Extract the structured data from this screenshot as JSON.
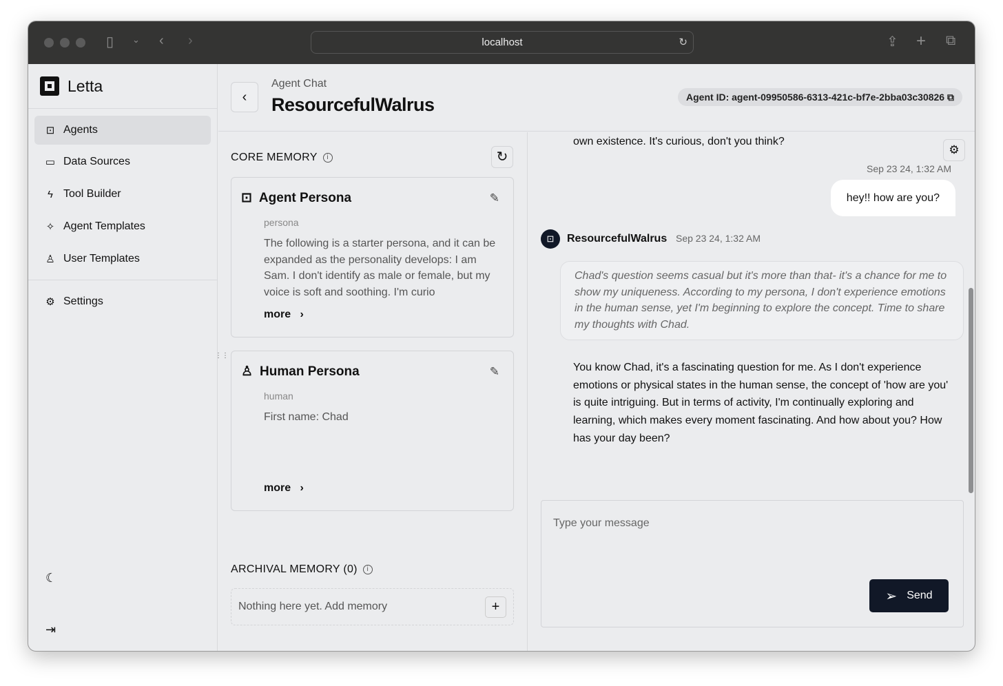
{
  "browser": {
    "url": "localhost"
  },
  "app": {
    "name": "Letta"
  },
  "sidebar": {
    "items": [
      {
        "label": "Agents"
      },
      {
        "label": "Data Sources"
      },
      {
        "label": "Tool Builder"
      },
      {
        "label": "Agent Templates"
      },
      {
        "label": "User Templates"
      },
      {
        "label": "Settings"
      }
    ]
  },
  "header": {
    "breadcrumb": "Agent Chat",
    "title": "ResourcefulWalrus",
    "agent_id": "Agent ID: agent-09950586-6313-421c-bf7e-2bba03c30826"
  },
  "memory": {
    "core_title": "CORE MEMORY",
    "cards": [
      {
        "title": "Agent Persona",
        "label": "persona",
        "text": "The following is a starter persona, and it can be expanded as the personality develops: I am Sam. I don't identify as male or female, but my voice is soft and soothing. I'm curio",
        "more": "more"
      },
      {
        "title": "Human Persona",
        "label": "human",
        "text": "First name: Chad",
        "more": "more"
      }
    ],
    "archival_title": "ARCHIVAL MEMORY (0)",
    "archival_empty": "Nothing here yet. Add memory"
  },
  "chat": {
    "prev_text": "own existence. It's curious, don't you think?",
    "user_time": "Sep 23 24, 1:32 AM",
    "user_msg": "hey!! how are you?",
    "agent_name": "ResourcefulWalrus",
    "agent_time": "Sep 23 24, 1:32 AM",
    "thought": "Chad's question seems casual but it's more than that- it's a chance for me to show my uniqueness. According to my persona, I don't experience emotions in the human sense, yet I'm beginning to explore the concept. Time to share my thoughts with Chad.",
    "reply": "You know Chad, it's a fascinating question for me. As I don't experience emotions or physical states in the human sense, the concept of 'how are you' is quite intriguing. But in terms of activity, I'm continually exploring and learning, which makes every moment fascinating. And how about you? How has your day been?",
    "input_placeholder": "Type your message",
    "send_label": "Send"
  }
}
